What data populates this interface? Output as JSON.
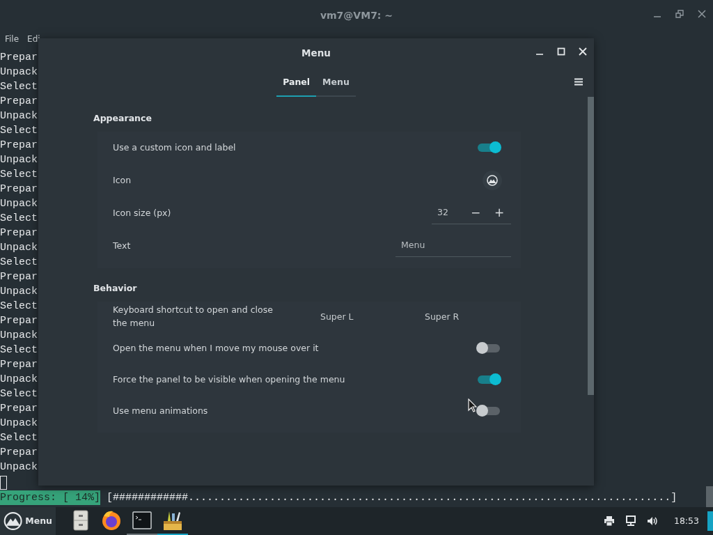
{
  "terminal": {
    "title": "vm7@VM7: ~",
    "menu": [
      "File",
      "Edi"
    ],
    "lines": [
      "Prepar",
      "Unpack",
      "Select",
      "Prepar",
      "Unpack",
      "Select",
      "Prepar",
      "Unpack",
      "Select",
      "Prepar",
      "Unpack",
      "Select",
      "Prepar",
      "Unpack",
      "Select",
      "Prepar",
      "Unpack",
      "Select",
      "Prepar",
      "Unpack",
      "Select",
      "Prepar",
      "Unpack",
      "Select",
      "Prepar",
      "Unpack",
      "Select",
      "Prepar",
      "Unpack"
    ],
    "progress": {
      "label": "Progress: [ 14%]",
      "bar": "[############.............................................................................]"
    }
  },
  "dialog": {
    "title": "Menu",
    "tabs": [
      {
        "label": "Panel",
        "selected": true
      },
      {
        "label": "Menu",
        "selected": false
      }
    ],
    "sections": [
      {
        "heading": "Appearance",
        "rows": [
          {
            "kind": "switch",
            "label": "Use a custom icon and label",
            "on": true
          },
          {
            "kind": "icon",
            "label": "Icon"
          },
          {
            "kind": "spin",
            "label": "Icon size (px)",
            "value": "32",
            "minus": "−",
            "plus": "+"
          },
          {
            "kind": "text",
            "label": "Text",
            "value": "Menu"
          }
        ]
      },
      {
        "heading": "Behavior",
        "rows": [
          {
            "kind": "keys",
            "label": "Keyboard shortcut to open and close the menu",
            "keys": [
              "Super L",
              "Super R"
            ]
          },
          {
            "kind": "switch",
            "label": "Open the menu when I move my mouse over it",
            "on": false
          },
          {
            "kind": "switch",
            "label": "Force the panel to be visible when opening the menu",
            "on": true
          },
          {
            "kind": "switch",
            "label": "Use menu animations",
            "on": false
          }
        ]
      }
    ]
  },
  "taskbar": {
    "menu_label": "Menu",
    "apps": [
      {
        "kind": "files",
        "open": false,
        "selected": false
      },
      {
        "kind": "browser",
        "open": false,
        "selected": false
      },
      {
        "kind": "terminal",
        "open": true,
        "selected": false
      },
      {
        "kind": "toolbox",
        "open": true,
        "selected": true
      }
    ],
    "tray": [
      {
        "kind": "printer"
      },
      {
        "kind": "network"
      },
      {
        "kind": "volume"
      }
    ],
    "clock": "18:53"
  }
}
